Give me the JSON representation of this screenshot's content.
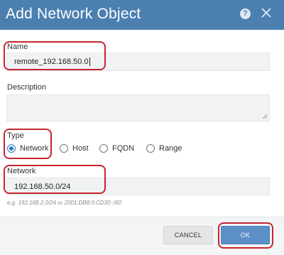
{
  "dialog": {
    "title": "Add Network Object",
    "help_icon": "?",
    "close_icon": "close-icon"
  },
  "form": {
    "name_label": "Name",
    "name_value": "remote_192.168.50.0",
    "description_label": "Description",
    "description_value": "",
    "type_label": "Type",
    "type_options": [
      {
        "label": "Network",
        "selected": true
      },
      {
        "label": "Host",
        "selected": false
      },
      {
        "label": "FQDN",
        "selected": false
      },
      {
        "label": "Range",
        "selected": false
      }
    ],
    "network_label": "Network",
    "network_value": "192.168.50.0/24",
    "network_hint": "e.g. 192.168.2.0/24 or 2001:DB8:0:CD30::/60"
  },
  "footer": {
    "cancel_label": "CANCEL",
    "ok_label": "OK"
  },
  "colors": {
    "header": "#4a7fb0",
    "primary_button": "#5b8fc6",
    "highlight": "#c6252f",
    "radio_selected": "#2d7cc1"
  }
}
